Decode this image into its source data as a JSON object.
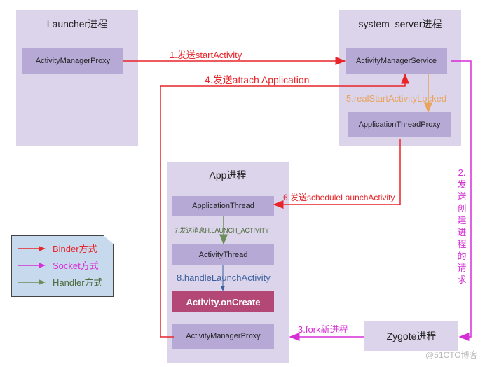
{
  "processes": {
    "launcher": {
      "title": "Launcher进程",
      "boxes": [
        "ActivityManagerProxy"
      ]
    },
    "system_server": {
      "title": "system_server进程",
      "boxes": [
        "ActivityManagerService",
        "ApplicationThreadProxy"
      ]
    },
    "app": {
      "title": "App进程",
      "boxes": [
        "ApplicationThread",
        "ActivityThread",
        "Activity.onCreate",
        "ActivityManagerProxy"
      ]
    },
    "zygote": {
      "title": "Zygote进程"
    }
  },
  "arrows": {
    "step1": "1.发送startActivity",
    "step2": "2.发送创建进程的请求",
    "step2_chars": [
      "2.",
      "发",
      "送",
      "创",
      "建",
      "进",
      "程",
      "的",
      "请",
      "求"
    ],
    "step3": "3.fork新进程",
    "step4": "4.发送attach Application",
    "step5": "5.realStartActivityLocked",
    "step6": "6.发送scheduleLaunchActivity",
    "step7": "7.发送消息H.LAUNCH_ACTIVITY",
    "step8": "8.handleLaunchActivity"
  },
  "legend": [
    {
      "label": "Binder方式",
      "color": "#e8252a"
    },
    {
      "label": "Socket方式",
      "color": "#d62fd6"
    },
    {
      "label": "Handler方式",
      "color": "#6b8e5a"
    }
  ],
  "colors": {
    "binder": "#e8252a",
    "socket": "#d62fd6",
    "handler": "#6b8e5a",
    "orange": "#e8a45c",
    "blue": "#3a5f9e"
  },
  "watermark": "@51CTO博客"
}
